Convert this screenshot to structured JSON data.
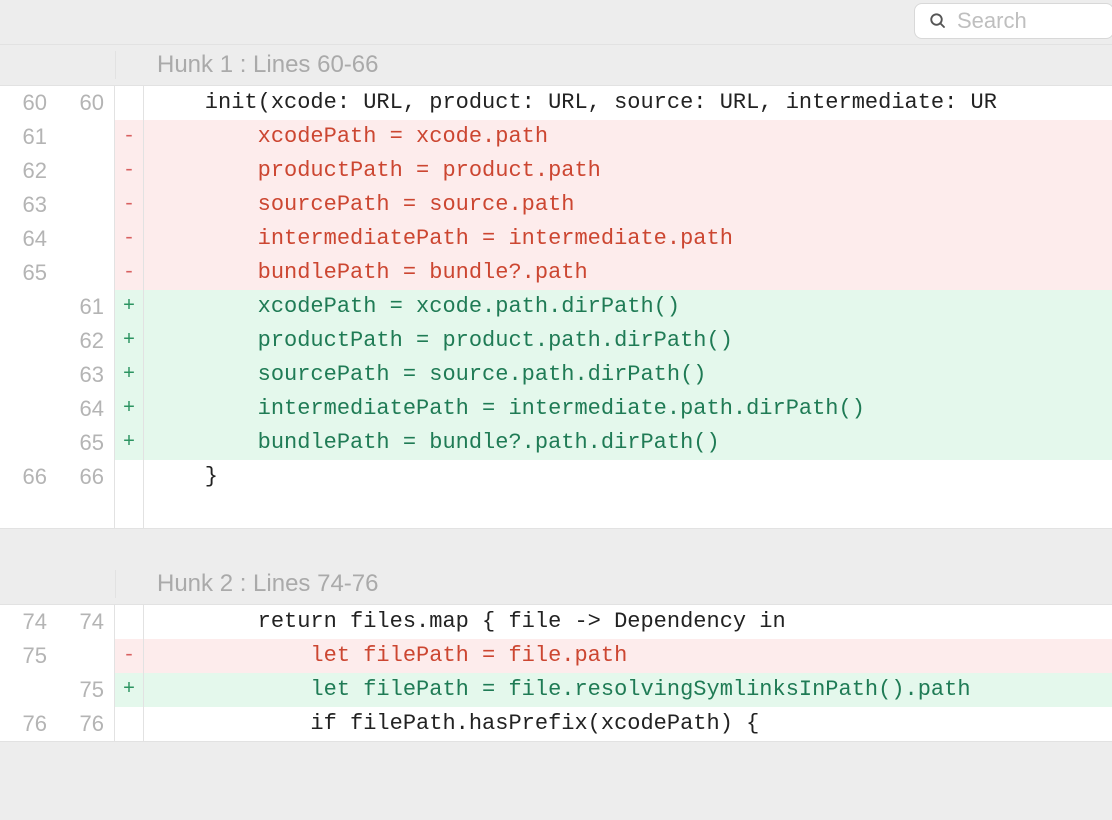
{
  "search": {
    "placeholder": "Search"
  },
  "colors": {
    "del_bg": "#fdecec",
    "del_fg": "#cc4631",
    "add_bg": "#e4f8ec",
    "add_fg": "#1f7b55",
    "gutter": "#b4b4b4"
  },
  "hunks": [
    {
      "header": "Hunk 1 : Lines 60-66",
      "lines": [
        {
          "old": "60",
          "new": "60",
          "type": "context",
          "marker": " ",
          "code": "    init(xcode: URL, product: URL, source: URL, intermediate: UR"
        },
        {
          "old": "61",
          "new": "",
          "type": "del",
          "marker": "-",
          "code": "        xcodePath = xcode.path"
        },
        {
          "old": "62",
          "new": "",
          "type": "del",
          "marker": "-",
          "code": "        productPath = product.path"
        },
        {
          "old": "63",
          "new": "",
          "type": "del",
          "marker": "-",
          "code": "        sourcePath = source.path"
        },
        {
          "old": "64",
          "new": "",
          "type": "del",
          "marker": "-",
          "code": "        intermediatePath = intermediate.path"
        },
        {
          "old": "65",
          "new": "",
          "type": "del",
          "marker": "-",
          "code": "        bundlePath = bundle?.path"
        },
        {
          "old": "",
          "new": "61",
          "type": "add",
          "marker": "+",
          "code": "        xcodePath = xcode.path.dirPath()"
        },
        {
          "old": "",
          "new": "62",
          "type": "add",
          "marker": "+",
          "code": "        productPath = product.path.dirPath()"
        },
        {
          "old": "",
          "new": "63",
          "type": "add",
          "marker": "+",
          "code": "        sourcePath = source.path.dirPath()"
        },
        {
          "old": "",
          "new": "64",
          "type": "add",
          "marker": "+",
          "code": "        intermediatePath = intermediate.path.dirPath()"
        },
        {
          "old": "",
          "new": "65",
          "type": "add",
          "marker": "+",
          "code": "        bundlePath = bundle?.path.dirPath()"
        },
        {
          "old": "66",
          "new": "66",
          "type": "context",
          "marker": " ",
          "code": "    }"
        }
      ]
    },
    {
      "header": "Hunk 2 : Lines 74-76",
      "lines": [
        {
          "old": "74",
          "new": "74",
          "type": "context",
          "marker": " ",
          "code": "        return files.map { file -> Dependency in"
        },
        {
          "old": "75",
          "new": "",
          "type": "del",
          "marker": "-",
          "code": "            let filePath = file.path"
        },
        {
          "old": "",
          "new": "75",
          "type": "add",
          "marker": "+",
          "code": "            let filePath = file.resolvingSymlinksInPath().path"
        },
        {
          "old": "76",
          "new": "76",
          "type": "context",
          "marker": " ",
          "code": "            if filePath.hasPrefix(xcodePath) {"
        }
      ]
    }
  ]
}
